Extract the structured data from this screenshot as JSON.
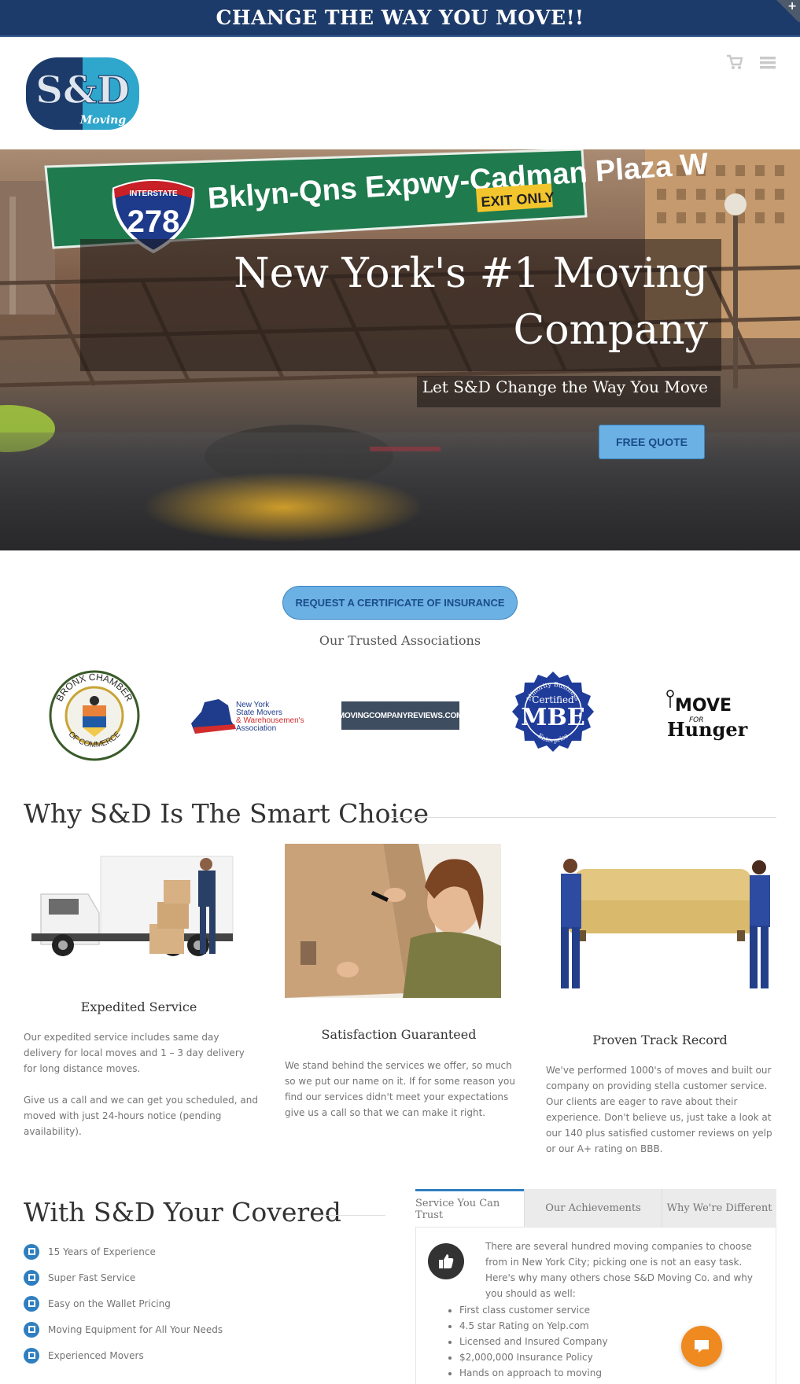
{
  "banner": {
    "text": "CHANGE THE WAY YOU MOVE!!"
  },
  "header": {
    "logo_text": "S&D",
    "logo_script": "Moving"
  },
  "hero": {
    "title_line1": "New York's #1 Moving",
    "title_line2": "Company",
    "subtitle": "Let S&D Change the Way You Move",
    "cta_label": "FREE QUOTE",
    "sign_text": "Bklyn-Qns Expwy-Cadman Plaza W",
    "sign_exit": "EXIT ONLY",
    "shield_top": "INTERSTATE",
    "shield_number": "278"
  },
  "certificate": {
    "button_label": "REQUEST A CERTIFICATE OF INSURANCE"
  },
  "associations": {
    "title": "Our Trusted Associations",
    "items": [
      {
        "name": "BRONX CHAMBER OF COMMERCE",
        "top": "BRONX CHAMBER",
        "bottom": "OF COMMERCE"
      },
      {
        "name": "New York State Movers & Warehousemen's Association",
        "line1": "New York",
        "line2": "State Movers",
        "line3": "& Warehousemen's",
        "line4": "Association"
      },
      {
        "name": "MOVINGCOMPANYREVIEWS.COM"
      },
      {
        "name": "Certified MBE",
        "top": "Minority Business",
        "middle": "Certified",
        "mark": "MBE",
        "bottom": "Enterprise"
      },
      {
        "name": "MOVE FOR Hunger",
        "move": "MOVE",
        "for": "FOR",
        "hunger": "Hunger"
      }
    ]
  },
  "why": {
    "title": "Why S&D Is The Smart Choice",
    "features": [
      {
        "heading": "Expedited Service",
        "paragraphs": [
          "Our expedited service includes same day delivery for local moves and 1 – 3 day delivery for long distance moves.",
          "Give us a call and we can get you scheduled, and moved with just 24-hours notice (pending availability)."
        ]
      },
      {
        "heading": "Satisfaction Guaranteed",
        "paragraphs": [
          "We stand behind the services we offer, so much so we put our name on it. If for some reason you find our services didn't meet your expectations give us a call so that we can make it right."
        ]
      },
      {
        "heading": "Proven Track Record",
        "paragraphs": [
          "We've performed 1000's of moves and built our company on providing stella customer service. Our clients are eager to rave about their experience. Don't believe us, just take a look at our 140 plus satisfied customer reviews on yelp or our A+ rating on BBB."
        ]
      }
    ]
  },
  "covered": {
    "title": "With S&D Your Covered",
    "items": [
      "15 Years of Experience",
      "Super Fast Service",
      "Easy on the Wallet Pricing",
      "Moving Equipment for All Your Needs",
      "Experienced Movers"
    ]
  },
  "tabs": {
    "labels": [
      "Service You Can Trust",
      "Our Achievements",
      "Why We're Different"
    ],
    "active_index": 0,
    "intro": "There are several hundred moving companies to choose from in New York City; picking one is not an easy task. Here's why many others chose S&D Moving Co. and why you should as well:",
    "list": [
      "First class customer service",
      "4.5 star Rating on Yelp.com",
      "Licensed and Insured Company",
      "$2,000,000 Insurance Policy",
      "Hands on approach to moving"
    ]
  },
  "colors": {
    "brand_navy": "#1d3b6a",
    "accent_blue": "#2f7fc0",
    "button_blue": "#6bb1e3",
    "chat_orange": "#ef8a21"
  },
  "icons": [
    "cart-icon",
    "menu-icon",
    "check-icon",
    "thumbs-up-icon",
    "chat-icon"
  ]
}
